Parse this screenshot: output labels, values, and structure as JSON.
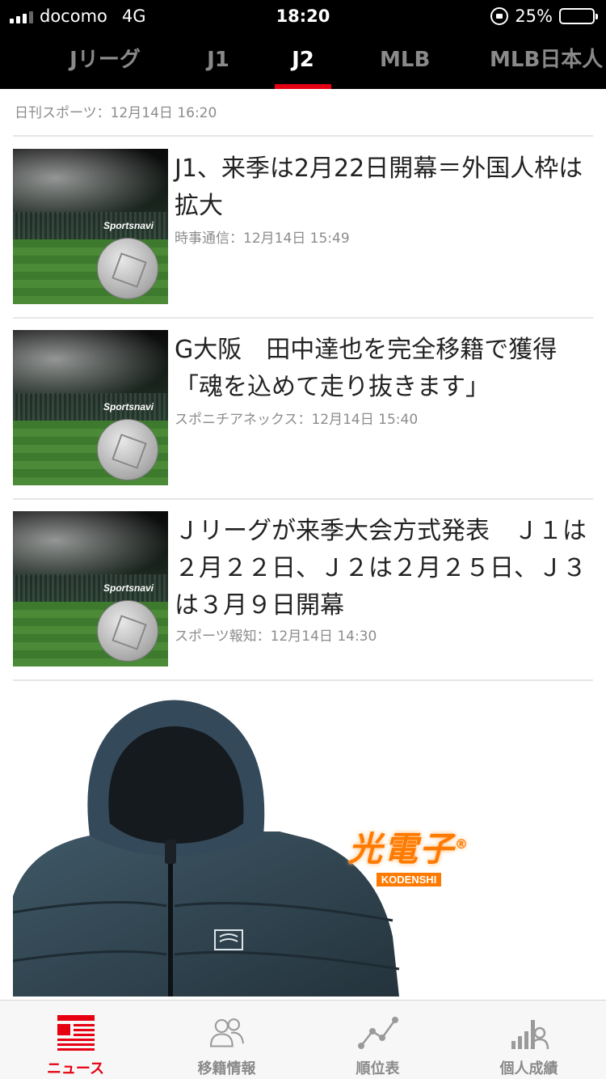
{
  "status_bar": {
    "carrier": "docomo",
    "network": "4G",
    "time": "18:20",
    "battery": "25%",
    "battery_level": 0.25
  },
  "tabs": [
    {
      "label": "Jリーグ",
      "active": false
    },
    {
      "label": "J1",
      "active": false
    },
    {
      "label": "J2",
      "active": true
    },
    {
      "label": "MLB",
      "active": false
    },
    {
      "label": "MLB日本人",
      "active": false
    }
  ],
  "top_source": "日刊スポーツ：12月14日 16:20",
  "articles": [
    {
      "headline": "J1、来季は2月22日開幕＝外国人枠は拡大",
      "meta": "時事通信：12月14日 15:49",
      "thumb_brand": "Sportsnavi"
    },
    {
      "headline": "G大阪　田中達也を完全移籍で獲得「魂を込めて走り抜きます」",
      "meta": "スポニチアネックス：12月14日 15:40",
      "thumb_brand": "Sportsnavi"
    },
    {
      "headline": "Ｊリーグが来季大会方式発表　Ｊ１は２月２２日、Ｊ２は２月２５日、Ｊ３は３月９日開幕",
      "meta": "スポーツ報知：12月14日 14:30",
      "thumb_brand": "Sportsnavi"
    }
  ],
  "ad": {
    "brand_kanji": "光電子",
    "brand_latin": "KODENSHI",
    "brand_mark": "®"
  },
  "bottom_nav": [
    {
      "label": "ニュース",
      "icon": "news-icon",
      "active": true
    },
    {
      "label": "移籍情報",
      "icon": "people-icon",
      "active": false
    },
    {
      "label": "順位表",
      "icon": "trend-chart-icon",
      "active": false
    },
    {
      "label": "個人成績",
      "icon": "bar-stats-icon",
      "active": false
    }
  ],
  "colors": {
    "accent": "#e60012",
    "header_bg": "#000000",
    "battery_fill": "#ffcc00"
  }
}
